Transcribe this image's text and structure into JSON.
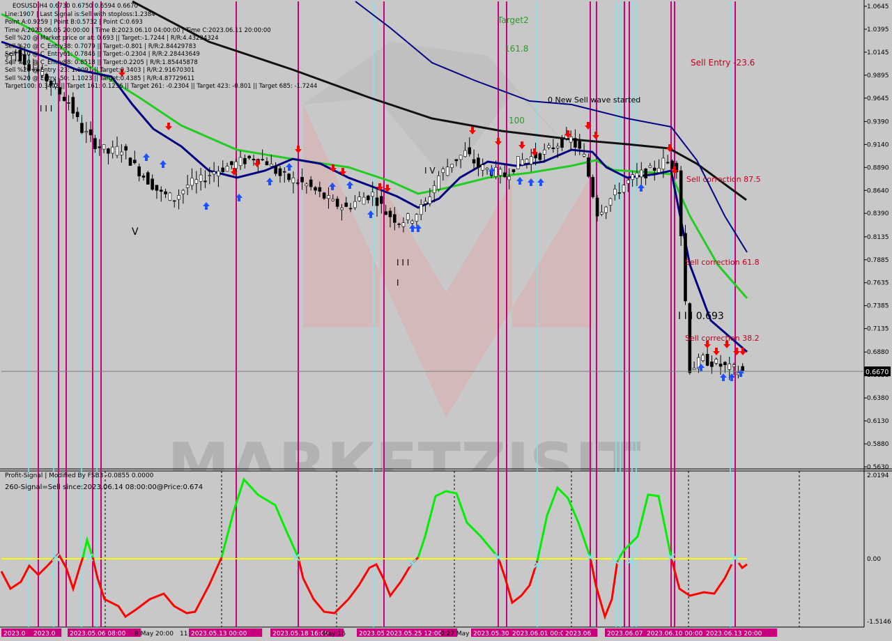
{
  "symbol_header": "EOSUSD,H4  0.6730 0.6750 0.6594 0.6670",
  "info_lines": [
    "Line:1907 | Last Signal is:Sell with stoploss:1.2384",
    "Point A:0.9259 | Point B:0.5732 | Point C:0.693",
    "Time A:2023.06.05 20:00:00 | Time B:2023.06.10 04:00:00 | Time C:2023.06.11 20:00:00",
    "Sell %20 @ Market price or at: 0.693 || Target:-1.7244 | R/R:4.43234324",
    "Sell %20 @ C_Entry38: 0.7079 || Target:-0.801 | R/R:2.84429783",
    "Sell %10 @ C_Entry61: 0.7846 || Target:-0.2304 | R/R:2.28443649",
    "Sell %10 @ C_Entry88: 0.8518 || Target:0.2205 | R/R:1.85445878",
    "Sell %20 @ Entry -23: 1.0091 || Target:0.3403 | R/R:2.91670301",
    "Sell %20 @ Entry -50: 1.1023 || Target:0.4385 | R/R:4.87729611",
    "Target100: 0.3403 || Target 161: 0.1236 || Target 261: -0.2304 || Target 423: -0.801 || Target 685: -1.7244"
  ],
  "main_annotations": {
    "target2": "Target2",
    "fib161": "161.8",
    "fib100": "100",
    "new_wave": "0 New Sell wave started",
    "sell_entry": "Sell Entry -23.6",
    "corr875": "Sell correction 87.5",
    "corr618": "Sell correction 61.8",
    "corr382": "Sell correction 38.2",
    "point_c": "I I I 0.693",
    "wave_iii": "I I I",
    "wave_ii": "I I I",
    "wave_v": "V",
    "wave_iv": "I V",
    "wave_i": "I"
  },
  "price_axis": [
    "1.0645",
    "1.0395",
    "1.0145",
    "0.9895",
    "0.9645",
    "0.9390",
    "0.9140",
    "0.8890",
    "0.8640",
    "0.8390",
    "0.8135",
    "0.7885",
    "0.7635",
    "0.7385",
    "0.7135",
    "0.6880",
    "0.6630",
    "0.6380",
    "0.6130",
    "0.5880",
    "0.5630"
  ],
  "current_price": "0.6670",
  "indicator": {
    "title": "Profit-Signal | Modified By FSB3 -0.0855 0.0000",
    "signal": "260-Signal=Sell since:2023.06.14 08:00:00@Price:0.674",
    "axis": [
      "2.0194",
      "0.00",
      "-1.5146"
    ]
  },
  "time_labels": [
    {
      "text": "2023.0",
      "highlight": true
    },
    {
      "text": "2023.0",
      "highlight": true
    },
    {
      "text": "2023.05.06 08:00",
      "highlight": true
    },
    {
      "text": "8 May 20:00",
      "highlight": false
    },
    {
      "text": "11 May",
      "highlight": false
    },
    {
      "text": "2023.05.13 00:00",
      "highlight": true
    },
    {
      "text": "2023.05.18 16:00",
      "highlight": true
    },
    {
      "text": "May 16",
      "highlight": false
    },
    {
      "text": "2023.05",
      "highlight": true
    },
    {
      "text": "2023.05.25 12:00",
      "highlight": true
    },
    {
      "text": "0 27 May",
      "highlight": false
    },
    {
      "text": "2023.05.30",
      "highlight": true
    },
    {
      "text": "2023.06.01 00:00",
      "highlight": true
    },
    {
      "text": "2023.06",
      "highlight": true
    },
    {
      "text": "2023.06.07",
      "highlight": true
    },
    {
      "text": "2023.06.10 00:00",
      "highlight": true
    },
    {
      "text": "2023.06.13 20:00",
      "highlight": true
    }
  ],
  "watermark": "MARKETZISIT",
  "colors": {
    "background": "#c8c8c8",
    "bull": "#000000",
    "ma_black": "#111111",
    "ma_green": "#22cc22",
    "ma_navy": "#000080",
    "ma_blue": "#1f2fa8",
    "magenta_line": "#c8007d",
    "cyan_line": "#7fe4ef",
    "sell_arrow": "#ff0000",
    "buy_arrow": "#1e50ff",
    "osc_red": "#ff0000",
    "osc_green": "#00ee00",
    "zero_line": "#ffff00",
    "annotation_red": "#c00020",
    "annotation_green": "#2a9a2a"
  },
  "chart_data": {
    "type": "line",
    "title": "EOSUSD,H4",
    "xlabel": "",
    "ylabel": "",
    "ylim": [
      0.563,
      1.0645
    ],
    "series": [
      {
        "name": "Close",
        "values": [
          1.01,
          1.015,
          1.0,
          0.99,
          0.975,
          0.96,
          0.93,
          0.915,
          0.905,
          0.91,
          0.89,
          0.875,
          0.86,
          0.855,
          0.87,
          0.875,
          0.885,
          0.89,
          0.895,
          0.9,
          0.895,
          0.88,
          0.875,
          0.87,
          0.86,
          0.85,
          0.845,
          0.855,
          0.86,
          0.84,
          0.83,
          0.835,
          0.85,
          0.88,
          0.895,
          0.905,
          0.89,
          0.885,
          0.88,
          0.895,
          0.9,
          0.905,
          0.915,
          0.92,
          0.9,
          0.84,
          0.855,
          0.87,
          0.88,
          0.885,
          0.895,
          0.89,
          0.67,
          0.68,
          0.675,
          0.67,
          0.667
        ]
      }
    ],
    "indicator_ylim": [
      -1.5146,
      2.0194
    ]
  }
}
